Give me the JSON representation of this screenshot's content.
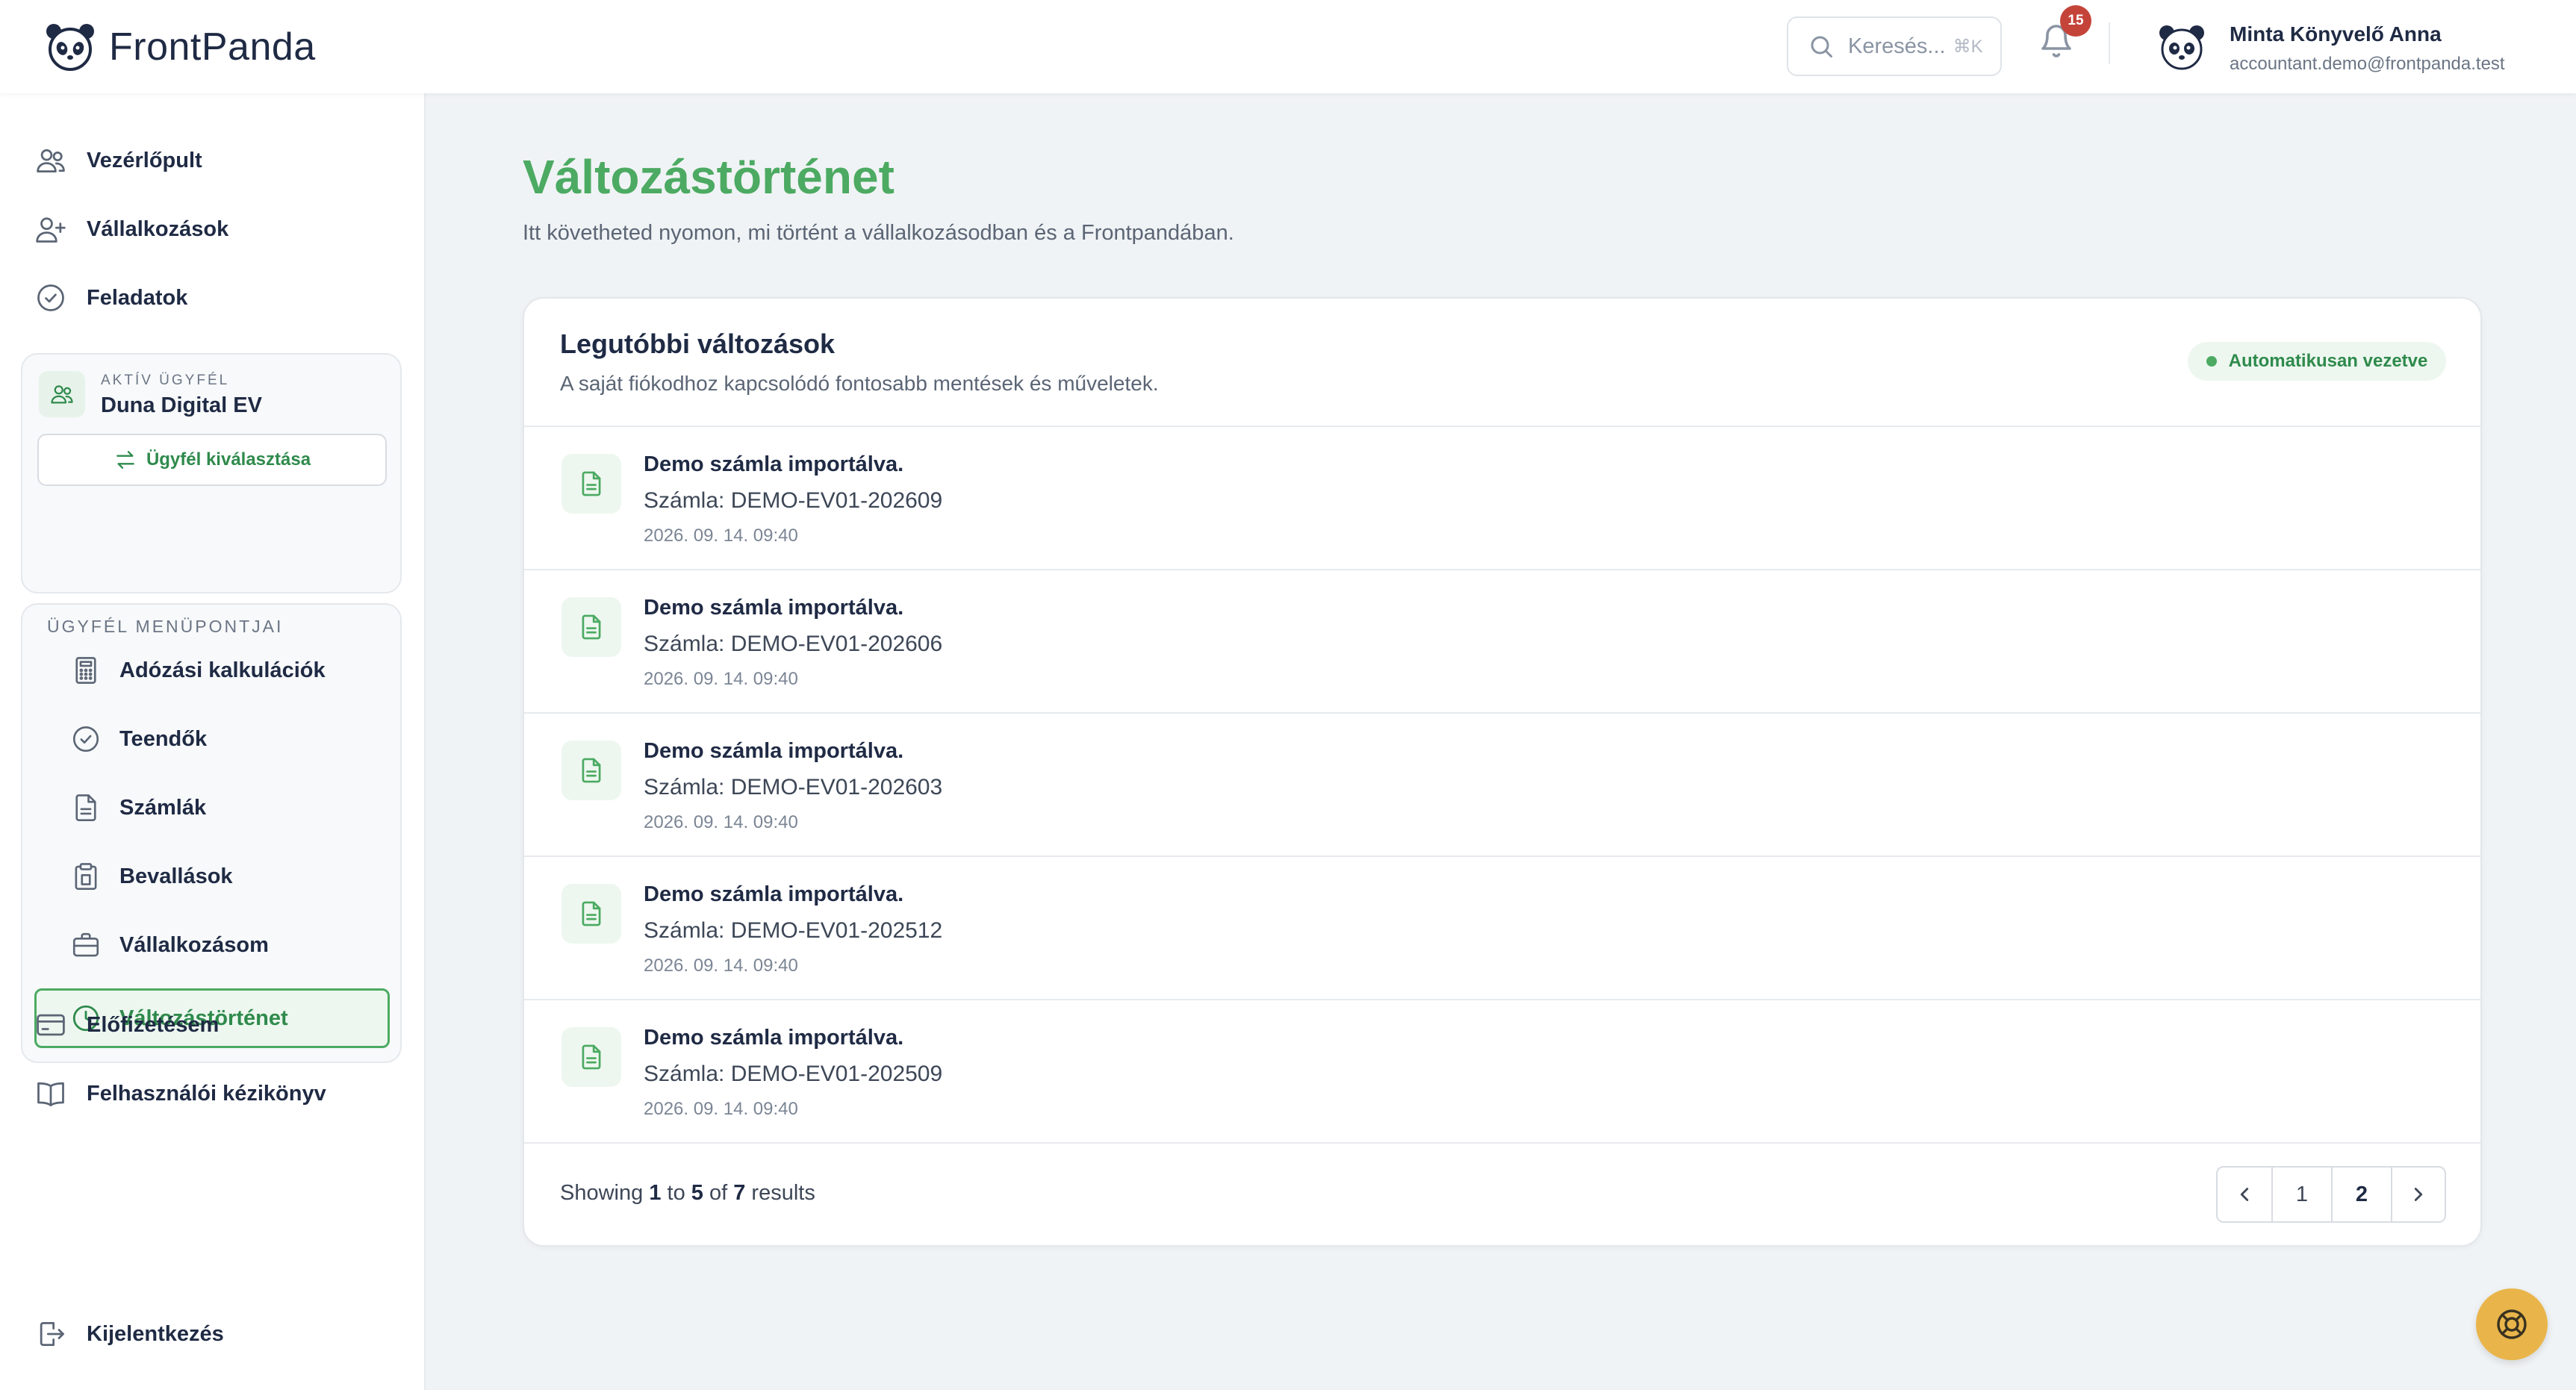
{
  "app": {
    "name": "FrontPanda"
  },
  "header": {
    "search_placeholder": "Keresés...",
    "search_shortcut": "⌘K",
    "notifications_count": "15",
    "user_name": "Minta Könyvelő Anna",
    "user_email": "accountant.demo@frontpanda.test"
  },
  "sidebar": {
    "top_items": [
      {
        "label": "Vezérlőpult",
        "icon": "users-icon"
      },
      {
        "label": "Vállalkozások",
        "icon": "user-plus-icon"
      },
      {
        "label": "Feladatok",
        "icon": "check-circle-icon"
      }
    ],
    "client": {
      "caption": "AKTÍV ÜGYFÉL",
      "name": "Duna Digital EV",
      "select_label": "Ügyfél kiválasztása"
    },
    "client_menu": {
      "caption": "ÜGYFÉL MENÜPONTJAI",
      "items": [
        {
          "label": "Adózási kalkulációk",
          "icon": "calculator-icon"
        },
        {
          "label": "Teendők",
          "icon": "check-circle-icon"
        },
        {
          "label": "Számlák",
          "icon": "document-icon"
        },
        {
          "label": "Bevallások",
          "icon": "clipboard-icon"
        },
        {
          "label": "Vállalkozásom",
          "icon": "briefcase-icon"
        },
        {
          "label": "Változástörténet",
          "icon": "clock-icon",
          "active": true
        }
      ]
    },
    "bottom_items": [
      {
        "label": "Előfizetésem",
        "icon": "credit-card-icon"
      },
      {
        "label": "Felhasználói kézikönyv",
        "icon": "book-icon"
      }
    ],
    "logout_label": "Kijelentkezés"
  },
  "page": {
    "title": "Változástörténet",
    "subtitle": "Itt követheted nyomon, mi történt a vállalkozásodban és a Frontpandában."
  },
  "card": {
    "title": "Legutóbbi változások",
    "subtitle": "A saját fiókodhoz kapcsolódó fontosabb mentések és műveletek.",
    "badge": "Automatikusan vezetve",
    "entries": [
      {
        "title": "Demo számla importálva.",
        "desc": "Számla: DEMO-EV01-202609",
        "time": "2026. 09. 14. 09:40"
      },
      {
        "title": "Demo számla importálva.",
        "desc": "Számla: DEMO-EV01-202606",
        "time": "2026. 09. 14. 09:40"
      },
      {
        "title": "Demo számla importálva.",
        "desc": "Számla: DEMO-EV01-202603",
        "time": "2026. 09. 14. 09:40"
      },
      {
        "title": "Demo számla importálva.",
        "desc": "Számla: DEMO-EV01-202512",
        "time": "2026. 09. 14. 09:40"
      },
      {
        "title": "Demo számla importálva.",
        "desc": "Számla: DEMO-EV01-202509",
        "time": "2026. 09. 14. 09:40"
      }
    ],
    "results": {
      "prefix": "Showing",
      "from": "1",
      "to_word": "to",
      "to": "5",
      "of_word": "of",
      "total": "7",
      "suffix": "results"
    },
    "pagination": {
      "pages": [
        "1",
        "2"
      ],
      "current": "2"
    }
  },
  "colors": {
    "accent": "#4caa62",
    "badge_red": "#c4443a",
    "fab": "#e9b54a"
  }
}
